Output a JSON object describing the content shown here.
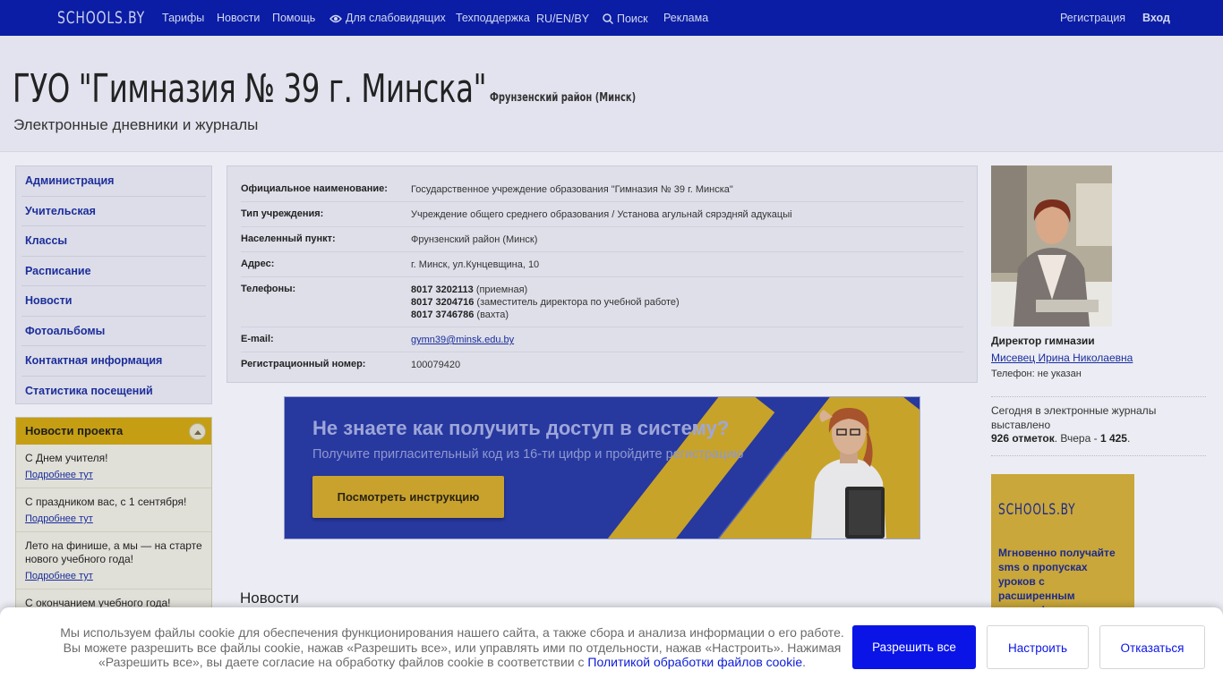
{
  "topnav": {
    "logo": "SCHOOLS.BY",
    "items": [
      "Тарифы",
      "Новости",
      "Помощь",
      "Для слабовидящих",
      "Техподдержка",
      "RU/EN/BY",
      "Поиск",
      "Реклама"
    ],
    "register": "Регистрация",
    "login": "Вход"
  },
  "header": {
    "title": "ГУО \"Гимназия № 39 г. Минска\"",
    "district": "Фрунзенский район (Минск)",
    "subtitle": "Электронные дневники и журналы"
  },
  "menu": [
    "Администрация",
    "Учительская",
    "Классы",
    "Расписание",
    "Новости",
    "Фотоальбомы",
    "Контактная информация",
    "Статистика посещений"
  ],
  "project_news": {
    "title": "Новости проекта",
    "more": "Подробнее тут",
    "items": [
      "С Днем учителя!",
      "С праздником вас, с 1 сентября!",
      "Лето на финише, а мы — на старте нового учебного года!",
      "С окончанием учебного года!"
    ]
  },
  "info": {
    "official_name_label": "Официальное наименование:",
    "official_name": "Государственное учреждение образования \"Гимназия № 39 г. Минска\"",
    "type_label": "Тип учреждения:",
    "type": "Учреждение общего среднего образования / Установа агульнай сярэдняй адукацыі",
    "locality_label": "Населенный пункт:",
    "locality": "Фрунзенский район (Минск)",
    "address_label": "Адрес:",
    "address": "г. Минск, ул.Кунцевщина, 10",
    "phones_label": "Телефоны:",
    "phones": [
      {
        "number": "8017 3202113",
        "note": "(приемная)"
      },
      {
        "number": "8017 3204716",
        "note": "(заместитель директора по учебной работе)"
      },
      {
        "number": "8017 3746786",
        "note": "(вахта)"
      }
    ],
    "email_label": "E-mail:",
    "email": "gymn39@minsk.edu.by",
    "reg_label": "Регистрационный номер:",
    "reg": "100079420"
  },
  "banner": {
    "headline": "Не знаете как получить доступ в систему?",
    "sub": "Получите пригласительный код из 16-ти цифр и пройдите регистрацию",
    "button": "Посмотреть инструкцию"
  },
  "news_section_title": "Новости",
  "director": {
    "label": "Директор гимназии",
    "name": "Мисевец Ирина Николаевна",
    "phone": "Телефон: не указан"
  },
  "today": {
    "text": "Сегодня в электронные журналы выставлено",
    "count": "926 отметок",
    "yesterday_label": ". Вчера - ",
    "yesterday": "1 425",
    "end": "."
  },
  "promo": {
    "logo": "SCHOOLS.BY",
    "text": "Мгновенно получайте sms о пропусках уроков с расширенным пакетом!"
  },
  "cookie": {
    "text": "Мы используем файлы cookie для обеспечения функционирования нашего сайта, а также сбора и анализа информации о его работе. Вы можете разрешить все файлы cookie, нажав «Разрешить все», или управлять ими по отдельности, нажав «Настроить». Нажимая «Разрешить все», вы даете согласие на обработку файлов cookie в соответствии с ",
    "link": "Политикой обработки файлов cookie",
    "end": ".",
    "allow": "Разрешить все",
    "settings": "Настроить",
    "decline": "Отказаться"
  },
  "colors": {
    "topbar": "#0b1da5",
    "accent_gold": "#c59e14",
    "cookie_primary": "#0a14e6"
  }
}
